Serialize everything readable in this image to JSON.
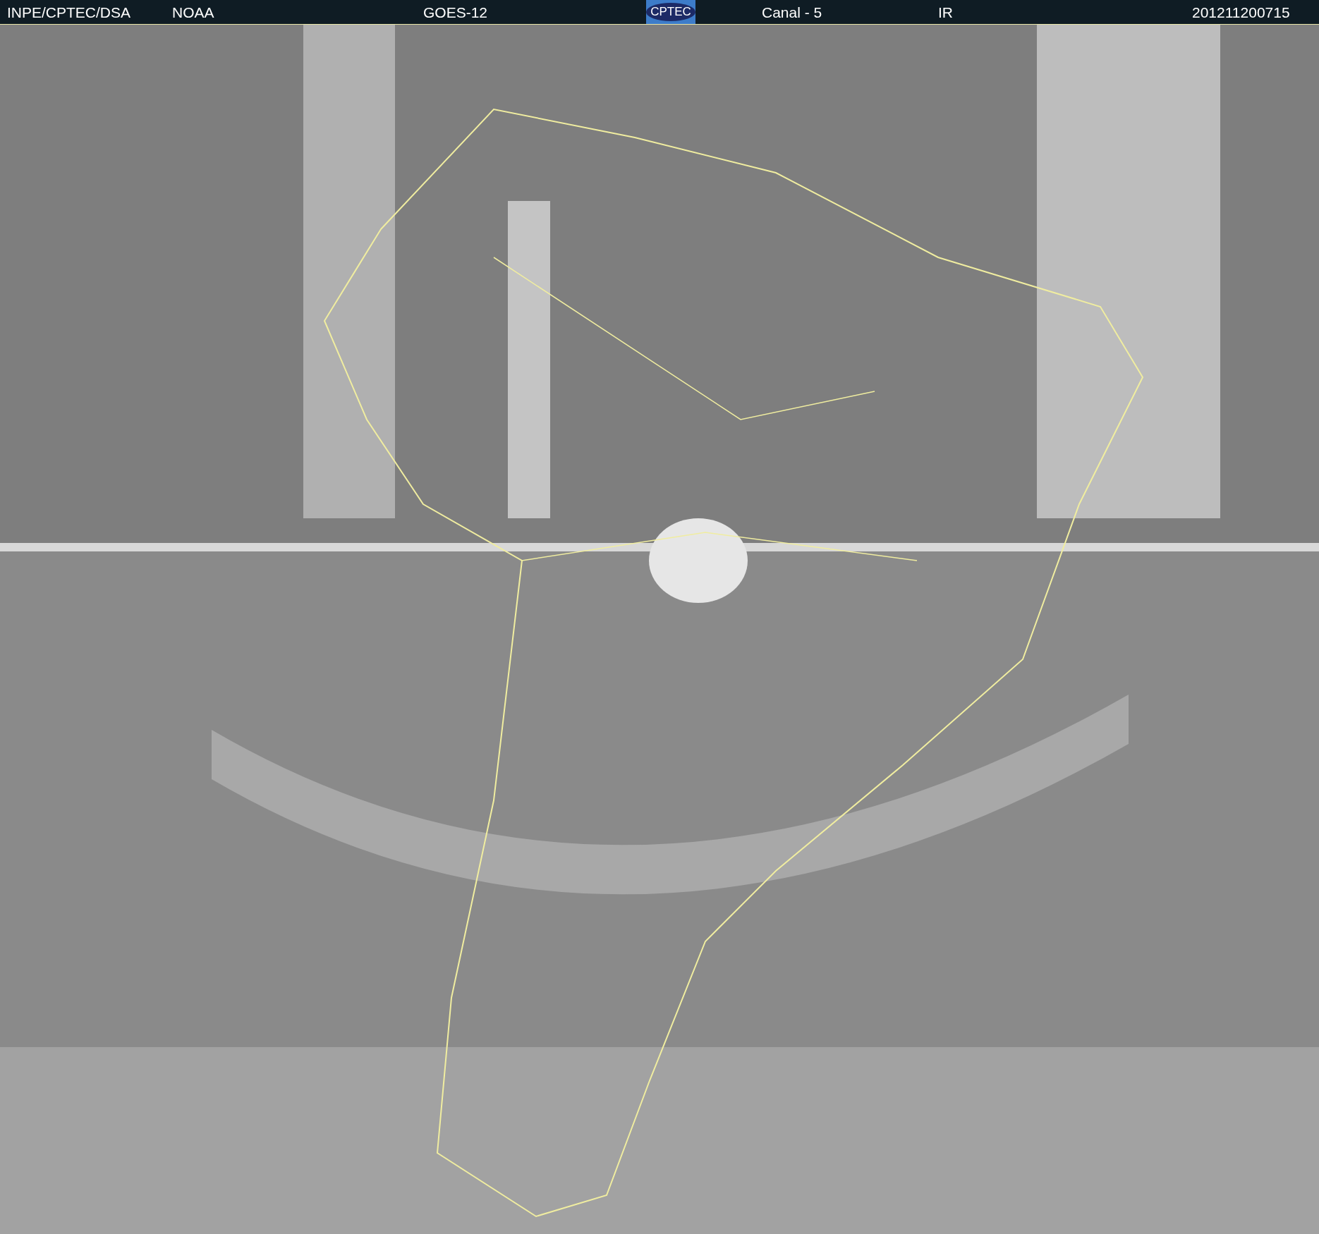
{
  "header": {
    "source": "INPE/CPTEC/DSA",
    "agency": "NOAA",
    "satellite": "GOES-12",
    "logo": "CPTEC",
    "channel": "Canal - 5",
    "band": "IR",
    "timestamp": "201211200715"
  }
}
